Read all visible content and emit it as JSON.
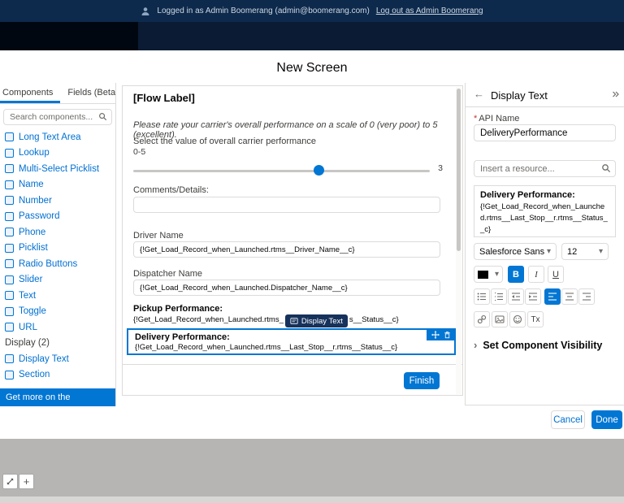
{
  "icons": {
    "back_arrow": "←",
    "chevron_down": "▾",
    "zoom_plus": "+"
  },
  "topbar": {
    "logged_in": "Logged in as Admin Boomerang (admin@boomerang.com)",
    "logout_link": "Log out as Admin Boomerang"
  },
  "modal": {
    "title": "New Screen",
    "cancel_label": "Cancel",
    "done_label": "Done"
  },
  "sidebar": {
    "tabs": [
      "Components",
      "Fields (Beta)"
    ],
    "search_placeholder": "Search components...",
    "items": [
      "Long Text Area",
      "Lookup",
      "Multi-Select Picklist",
      "Name",
      "Number",
      "Password",
      "Phone",
      "Picklist",
      "Radio Buttons",
      "Slider",
      "Text",
      "Toggle",
      "URL"
    ],
    "section_label": "Display (2)",
    "display_items": [
      "Display Text",
      "Section"
    ],
    "footer_link": "Get more on the AppExchange"
  },
  "canvas": {
    "flow_label": "[Flow Label]",
    "description": "Please rate your carrier's overall performance on a scale of 0 (very poor) to 5 (excellent).",
    "slider_label": "Select the value of overall carrier performance",
    "slider_range": "0-5",
    "slider_value": "3",
    "comments_label": "Comments/Details:",
    "driver_label": "Driver Name",
    "driver_value": "{!Get_Load_Record_when_Launched.rtms__Driver_Name__c}",
    "dispatcher_label": "Dispatcher Name",
    "dispatcher_value": "{!Get_Load_Record_when_Launched.Dispatcher_Name__c}",
    "pickup_label": "Pickup Performance:",
    "pickup_value_prefix": "{!Get_Load_Record_when_Launched.rtms_",
    "pickup_value_suffix": "s__Status__c}",
    "tooltip_label": "Display Text",
    "delivery_label": "Delivery Performance:",
    "delivery_value": "{!Get_Load_Record_when_Launched.rtms__Last_Stop__r.rtms__Status__c}",
    "finish_label": "Finish"
  },
  "panel": {
    "title": "Display Text",
    "required_mark": "*",
    "api_name_label": "API Name",
    "api_name_value": "DeliveryPerformance",
    "resource_placeholder": "Insert a resource...",
    "preview_heading": "Delivery Performance:",
    "preview_value": "{!Get_Load_Record_when_Launched.rtms__Last_Stop__r.rtms__Status__c}",
    "toolbar": {
      "font": "Salesforce Sans",
      "size": "12",
      "bold": "B",
      "italic": "I",
      "underline": "U",
      "clear_format": "Tx"
    },
    "visibility_label": "Set Component Visibility"
  }
}
